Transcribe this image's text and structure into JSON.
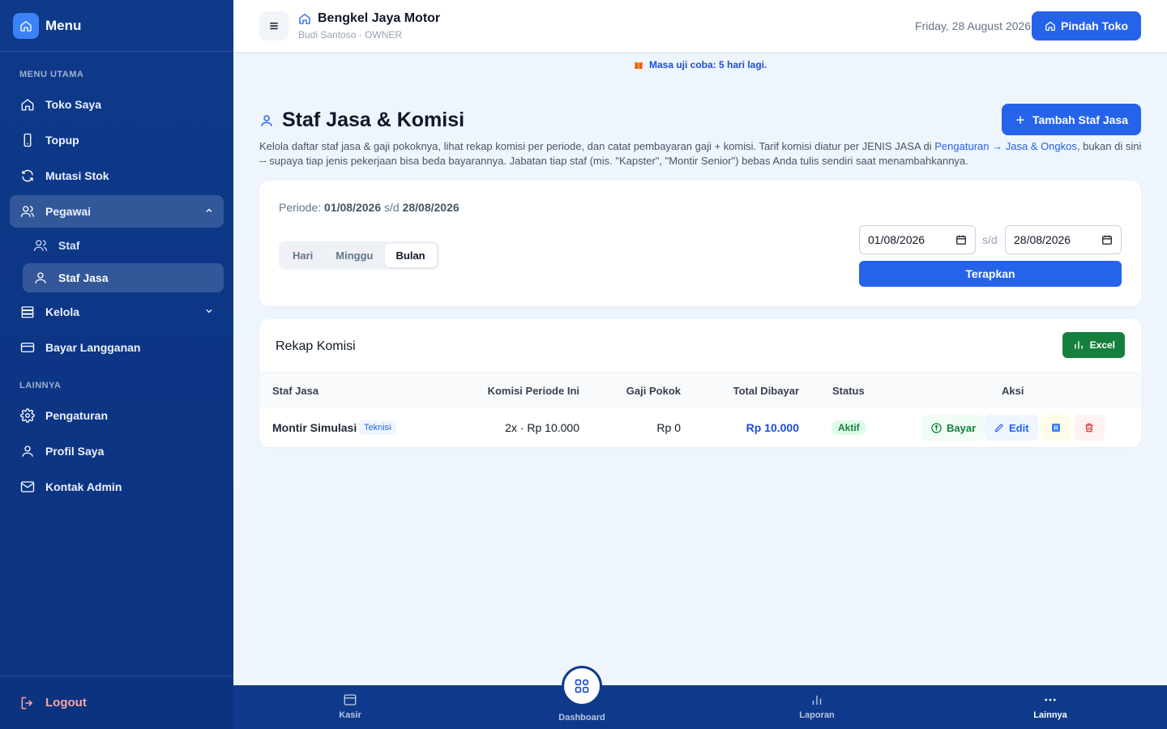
{
  "sidebar": {
    "title": "Menu",
    "section_main": "MENU UTAMA",
    "section_other": "LAINNYA",
    "items": {
      "toko_saya": "Toko Saya",
      "topup": "Topup",
      "mutasi_stok": "Mutasi Stok",
      "pegawai": "Pegawai",
      "staf": "Staf",
      "staf_jasa": "Staf Jasa",
      "kelola": "Kelola",
      "bayar_langganan": "Bayar Langganan",
      "pengaturan": "Pengaturan",
      "profil_saya": "Profil Saya",
      "kontak_admin": "Kontak Admin"
    },
    "logout": "Logout"
  },
  "header": {
    "shop_name": "Bengkel Jaya Motor",
    "shop_sub": "Budi Santoso · OWNER",
    "date": "Friday, 28 August 2026",
    "switch_store": "Pindah Toko"
  },
  "trial_notice": "Masa uji coba: 5 hari lagi.",
  "page": {
    "title": "Staf Jasa & Komisi",
    "add_button": "Tambah Staf Jasa",
    "desc_part1": "Kelola daftar staf jasa & gaji pokoknya, lihat rekap komisi per periode, dan catat pembayaran gaji + komisi. Tarif komisi diatur per JENIS JASA di ",
    "desc_link": "Pengaturan → Jasa & Ongkos",
    "desc_part2": ", bukan di sini -- supaya tiap jenis pekerjaan bisa beda bayarannya. Jabatan tiap staf (mis. \"Kapster\", \"Montir Senior\") bebas Anda tulis sendiri saat menambahkannya."
  },
  "period": {
    "label": "Periode:",
    "start": "01/08/2026",
    "sep": "s/d",
    "end": "28/08/2026",
    "tabs": [
      "Hari",
      "Minggu",
      "Bulan"
    ],
    "active_tab": "Bulan",
    "input_start": "01/08/2026",
    "input_end": "28/08/2026",
    "apply": "Terapkan"
  },
  "rekap": {
    "title": "Rekap Komisi",
    "excel": "Excel",
    "columns": {
      "staf": "Staf Jasa",
      "komisi": "Komisi Periode Ini",
      "gaji": "Gaji Pokok",
      "total": "Total Dibayar",
      "status": "Status",
      "aksi": "Aksi"
    },
    "rows": [
      {
        "name": "Montir Simulasi",
        "role": "Teknisi",
        "komisi": "2x · Rp 10.000",
        "gaji": "Rp 0",
        "total": "Rp 10.000",
        "status": "Aktif",
        "bayar": "Bayar",
        "edit": "Edit"
      }
    ]
  },
  "bottomnav": {
    "kasir": "Kasir",
    "dashboard": "Dashboard",
    "laporan": "Laporan",
    "lainnya": "Lainnya"
  },
  "colors": {
    "primary": "#2563eb",
    "sidebar": "#0e3a8a",
    "success": "#15803d",
    "danger": "#dc2626"
  }
}
